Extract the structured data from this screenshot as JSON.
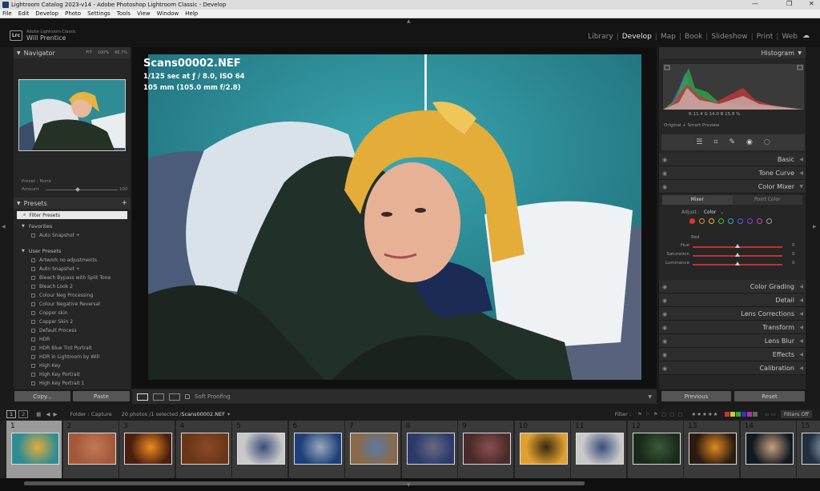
{
  "window": {
    "title": "Lightroom Catalog 2023-v14 - Adobe Photoshop Lightroom Classic - Develop",
    "controls": [
      "—",
      "❐",
      "✕"
    ]
  },
  "menu": [
    "File",
    "Edit",
    "Develop",
    "Photo",
    "Settings",
    "Tools",
    "View",
    "Window",
    "Help"
  ],
  "identity": {
    "badge": "Lrc",
    "product": "Adobe Lightroom Classic",
    "user": "Will Prentice"
  },
  "modules": [
    "Library",
    "Develop",
    "Map",
    "Book",
    "Slideshow",
    "Print",
    "Web"
  ],
  "active_module": "Develop",
  "navigator": {
    "title": "Navigator",
    "zoom": [
      "FIT",
      "100%",
      "66.7%"
    ],
    "preset_label": "Preset",
    "preset_value": "None",
    "amount_label": "Amount",
    "amount_value": "100"
  },
  "presets": {
    "title": "Presets",
    "filter": "Filter Presets",
    "favorites_group": "Favorites",
    "favorites": [
      "Auto Snapshot +"
    ],
    "user_group": "User Presets",
    "user_presets": [
      "Artwork no adjustments",
      "Auto Snapshot +",
      "Bleach Bypass with Split Tone",
      "Bleach Look 2",
      "Colour Neg Processing",
      "Colour Negative Reversal",
      "Copper skin",
      "Copper Skin 2",
      "Default Process",
      "HDR",
      "HDR Blue Tint Portrait",
      "HDR in Lightroom by Will",
      "High Key",
      "High Key Portrait",
      "High Key Portrait 1"
    ]
  },
  "left_buttons": {
    "copy": "Copy...",
    "paste": "Paste"
  },
  "photo_info": {
    "filename": "Scans00002.NEF",
    "exposure": "1/125 sec at ƒ / 8.0, ISO 64",
    "lens": "105 mm (105.0 mm f/2.8)"
  },
  "toolbar": {
    "soft_proofing": "Soft Proofing"
  },
  "histogram": {
    "title": "Histogram",
    "readout": "R 11.4  G 14.0  B 15.8 %",
    "preview": "Original + Smart Preview"
  },
  "right_panels": [
    "Basic",
    "Tone Curve",
    "Color Mixer",
    "Color Grading",
    "Detail",
    "Lens Corrections",
    "Transform",
    "Lens Blur",
    "Effects",
    "Calibration"
  ],
  "color_mixer": {
    "tabs": [
      "Mixer",
      "Point Color"
    ],
    "adjust_label": "Adjust :",
    "adjust_value": "Color",
    "selected": "Red",
    "sliders": [
      {
        "label": "Hue",
        "value": "0"
      },
      {
        "label": "Saturation",
        "value": "0"
      },
      {
        "label": "Luminance",
        "value": "0"
      }
    ],
    "swatch_colors": [
      "#e53030",
      "#e88a1a",
      "#e3c21a",
      "#3fbf3f",
      "#2bb3b3",
      "#3a6fe0",
      "#8a3fe0",
      "#d43fb8",
      "#9a9a9a"
    ]
  },
  "right_buttons": {
    "previous": "Previous",
    "reset": "Reset"
  },
  "filmstrip": {
    "folder_label": "Folder : Capture",
    "count": "20 photos /1 selected /",
    "current": "Scans00002.NEF",
    "filter_label": "Filter :",
    "filters_off": "Filters Off",
    "pages": [
      "1",
      "2"
    ],
    "numbers": [
      "1",
      "2",
      "3",
      "4",
      "5",
      "6",
      "7",
      "8",
      "9",
      "10",
      "11",
      "12",
      "13",
      "14",
      "15"
    ]
  }
}
